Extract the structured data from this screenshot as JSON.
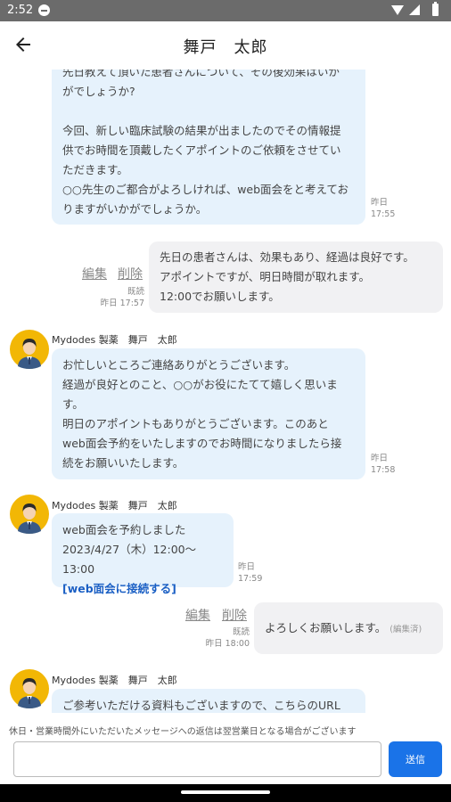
{
  "status": {
    "time": "2:52"
  },
  "header": {
    "title": "舞戸　太郎"
  },
  "messages": {
    "m1": {
      "lines": [
        "先日教えて頂いた患者さんについて、その後効果はいか",
        "がでしょうか?",
        "",
        "今回、新しい臨床試験の結果が出ましたのでその情報提",
        "供でお時間を頂戴したくアポイントのご依頼をさせてい",
        "ただきます。",
        "○○先生のご都合がよろしければ、web面会をと考えてお",
        "りますがいかがでしょうか。"
      ],
      "date": "昨日",
      "time": "17:55"
    },
    "m2": {
      "lines": [
        "先日の患者さんは、効果もあり、経過は良好です。",
        "アポイントですが、明日時間が取れます。",
        "12:00でお願いします。"
      ],
      "edit": "編集",
      "delete": "削除",
      "read": "既読",
      "datetime": "昨日 17:57"
    },
    "m3": {
      "sender": "Mydodes 製薬　舞戸　太郎",
      "lines": [
        "お忙しいところご連絡ありがとうございます。",
        "経過が良好とのこと、○○がお役にたてて嬉しく思いま",
        "す。",
        "明日のアポイントもありがとうございます。このあと",
        "web面会予約をいたしますのでお時間になりましたら接",
        "続をお願いいたします。"
      ],
      "date": "昨日",
      "time": "17:58"
    },
    "m4": {
      "sender": "Mydodes 製薬　舞戸　太郎",
      "line1": "web面会を予約しました",
      "line2": "2023/4/27（木）12:00～13:00",
      "link": "[web面会に接続する]",
      "date": "昨日",
      "time": "17:59"
    },
    "m5": {
      "text": "よろしくお願いします。",
      "edited": "(編集済)",
      "edit": "編集",
      "delete": "削除",
      "read": "既読",
      "datetime": "昨日 18:00"
    },
    "m6": {
      "sender": "Mydodes 製薬　舞戸　太郎",
      "line": "ご参考いただける資料もございますので、こちらのURL"
    }
  },
  "footer": {
    "notice": "休日・営業時間外にいただいたメッセージへの返信は翌営業日となる場合がございます",
    "input_value": "",
    "input_placeholder": "",
    "send_label": "送信"
  },
  "colors": {
    "incoming_bubble": "#e6f2fc",
    "outgoing_bubble": "#f1f1f3",
    "accent": "#1a73e8",
    "link": "#1a5fc4",
    "avatar_bg": "#f2b705"
  }
}
